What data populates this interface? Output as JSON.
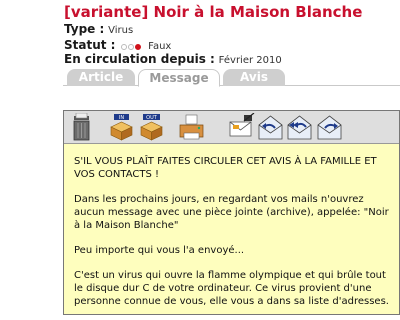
{
  "header": {
    "title": "[variante] Noir à la Maison Blanche",
    "type_label": "Type :",
    "type_value": "Virus",
    "statut_label": "Statut :",
    "statut_value": "Faux",
    "circulation_label": "En circulation depuis :",
    "circulation_value": "Février 2010"
  },
  "tabs": [
    {
      "label": "Article"
    },
    {
      "label": "Message",
      "active": true
    },
    {
      "label": "Avis"
    }
  ],
  "toolbar": {
    "icons": [
      "trash-icon",
      "inbox-icon",
      "outbox-icon",
      "print-icon",
      "compose-icon",
      "reply-icon",
      "reply-all-icon",
      "forward-icon"
    ],
    "in_label": "IN",
    "out_label": "OUT"
  },
  "message": {
    "paragraphs": [
      "S'IL VOUS PLAÎT FAITES CIRCULER CET AVIS À LA FAMILLE ET VOS CONTACTS !",
      "Dans les prochains jours, en regardant vos mails n'ouvrez aucun message avec une pièce jointe (archive),  appelée: \"Noir à la Maison Blanche\"",
      "Peu importe qui vous l'a envoyé...",
      "C'est un virus qui ouvre la flamme olympique et qui brûle tout le disque dur C de votre ordinateur. Ce virus provient d'une personne connue de vous, elle vous a dans sa liste d'adresses."
    ]
  },
  "colors": {
    "title": "#c8102e",
    "status_dot": "#d0101a",
    "panel_bg": "#fefebe",
    "toolbar_bg": "#dedede"
  }
}
